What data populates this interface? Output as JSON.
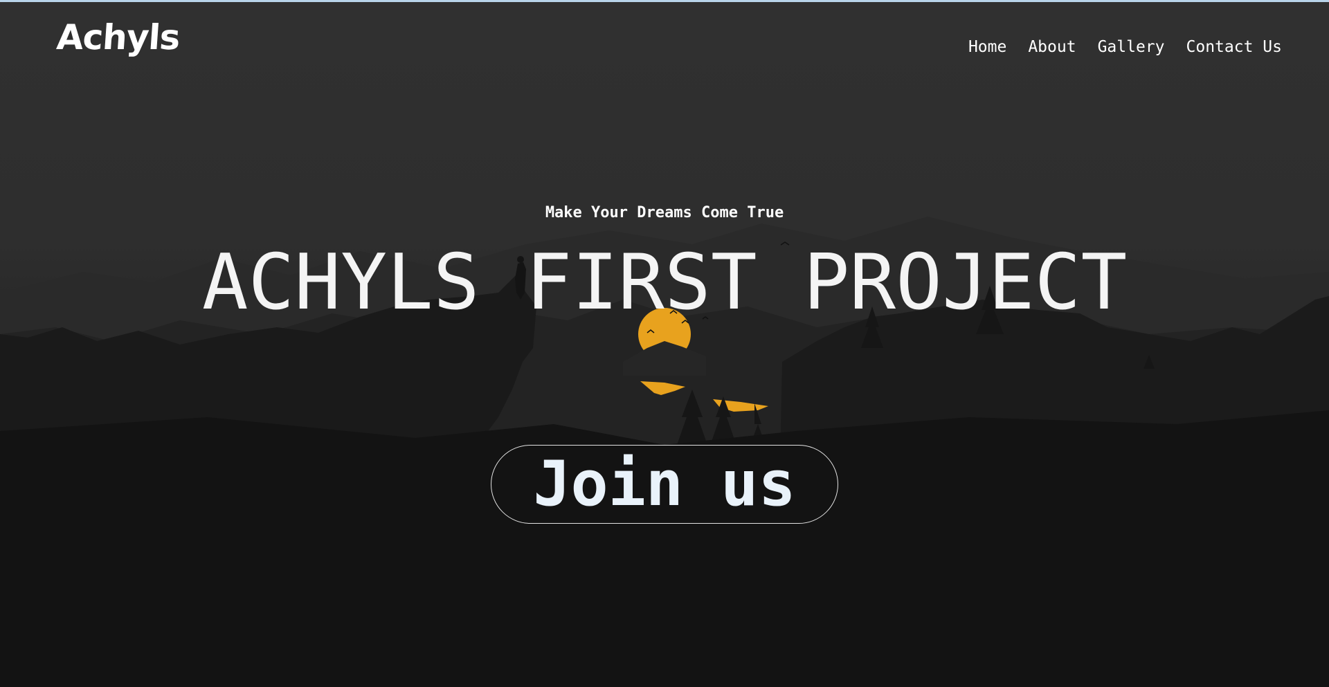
{
  "header": {
    "logo": "Achyls",
    "nav": [
      "Home",
      "About",
      "Gallery",
      "Contact Us"
    ]
  },
  "hero": {
    "tagline": "Make Your Dreams Come True",
    "title": "ACHYLS FIRST PROJECT",
    "cta_label": "Join us",
    "background_image": "mountain-sunset-silhouette"
  },
  "colors": {
    "text": "#ffffff",
    "sun": "#e8a21e",
    "button_border": "#e3e3e3",
    "button_text": "#e9f2fa",
    "top_border": "#b8d4ea"
  }
}
